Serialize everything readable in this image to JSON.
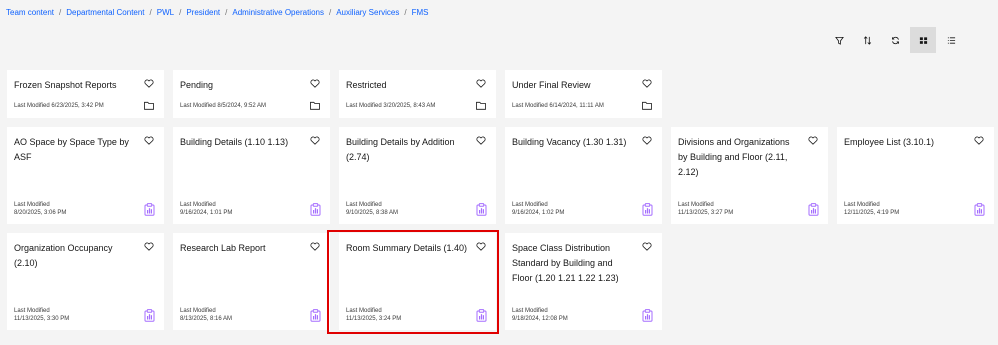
{
  "breadcrumb": {
    "items": [
      "Team content",
      "Departmental Content",
      "PWL",
      "President",
      "Administrative Operations",
      "Auxiliary Services",
      "FMS"
    ],
    "separator": "/"
  },
  "toolbar": {
    "icons": [
      "filter-icon",
      "sort-icon",
      "refresh-icon",
      "grid-view-icon",
      "list-view-icon"
    ],
    "active": "grid-view-icon"
  },
  "colors": {
    "link": "#0f62fe",
    "report_icon": "#a56eff",
    "highlight": "#e00000"
  },
  "folders": [
    {
      "title": "Frozen Snapshot Reports",
      "modified": "Last Modified 6/23/2025, 3:42 PM"
    },
    {
      "title": "Pending",
      "modified": "Last Modified 8/5/2024, 9:52 AM"
    },
    {
      "title": "Restricted",
      "modified": "Last Modified 3/20/2025, 8:43 AM"
    },
    {
      "title": "Under Final Review",
      "modified": "Last Modified 6/14/2024, 11:11 AM"
    }
  ],
  "reports_row1": [
    {
      "title": "AO Space by Space Type by ASF",
      "modified_label": "Last Modified",
      "modified_date": "8/20/2025, 3:06 PM"
    },
    {
      "title": "Building Details (1.10 1.13)",
      "modified_label": "Last Modified",
      "modified_date": "9/16/2024, 1:01 PM"
    },
    {
      "title": "Building Details by Addition (2.74)",
      "modified_label": "Last Modified",
      "modified_date": "9/10/2025, 8:38 AM"
    },
    {
      "title": "Building Vacancy (1.30 1.31)",
      "modified_label": "Last Modified",
      "modified_date": "9/16/2024, 1:02 PM"
    },
    {
      "title": "Divisions and Organizations by Building and Floor (2.11, 2.12)",
      "modified_label": "Last Modified",
      "modified_date": "11/13/2025, 3:27 PM"
    },
    {
      "title": "Employee List (3.10.1)",
      "modified_label": "Last Modified",
      "modified_date": "12/11/2025, 4:19 PM"
    }
  ],
  "reports_row2": [
    {
      "title": "Organization Occupancy (2.10)",
      "modified_label": "Last Modified",
      "modified_date": "11/13/2025, 3:30 PM"
    },
    {
      "title": "Research Lab Report",
      "modified_label": "Last Modified",
      "modified_date": "8/13/2025, 8:16 AM"
    },
    {
      "title": "Room Summary Details (1.40)",
      "modified_label": "Last Modified",
      "modified_date": "11/13/2025, 3:24 PM"
    },
    {
      "title": "Space Class Distribution Standard by Building and Floor (1.20 1.21 1.22 1.23)",
      "modified_label": "Last Modified",
      "modified_date": "9/18/2024, 12:08 PM"
    }
  ]
}
